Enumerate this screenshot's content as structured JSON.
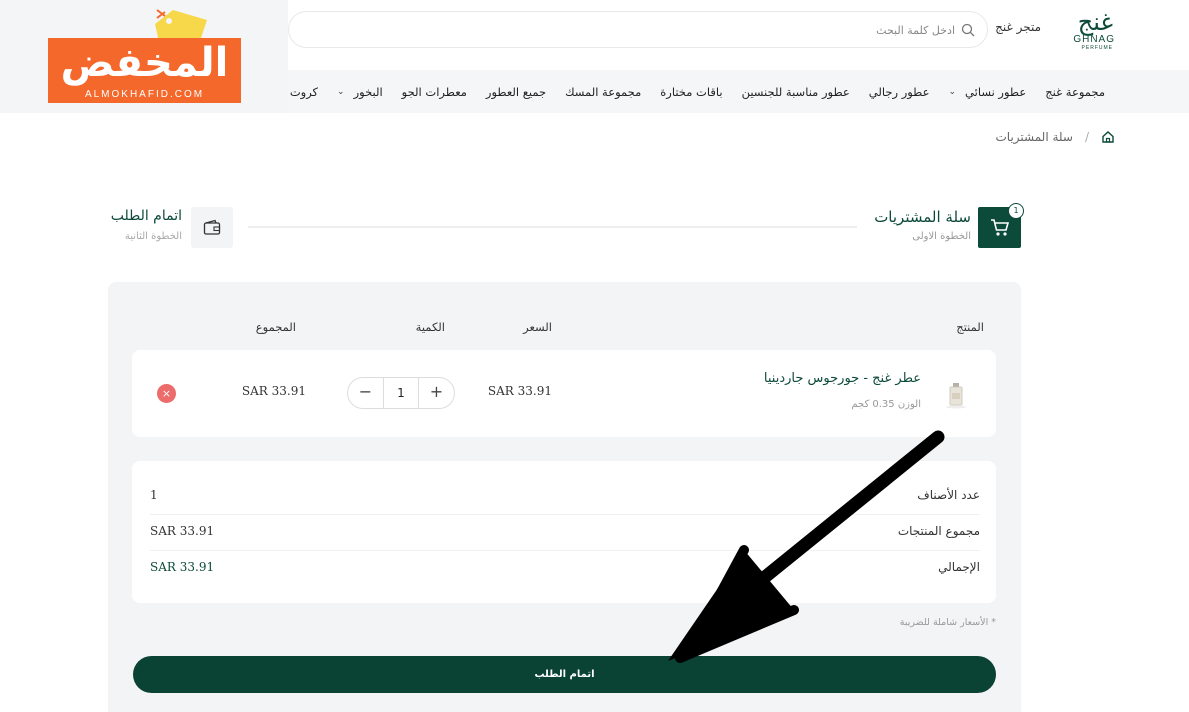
{
  "header": {
    "brand_script": "غنج",
    "brand_latin": "GHNAG",
    "brand_latin_sub": "PERFUME",
    "store_name": "متجر غنج",
    "search_placeholder": "ادخل كلمة البحث"
  },
  "nav": {
    "items": [
      {
        "label": "مجموعة غنج"
      },
      {
        "label": "عطور نسائي",
        "has_dropdown": true
      },
      {
        "label": "عطور رجالي"
      },
      {
        "label": "عطور مناسبة للجنسين"
      },
      {
        "label": "باقات مختارة"
      },
      {
        "label": "مجموعة المسك"
      },
      {
        "label": "جميع العطور"
      },
      {
        "label": "معطرات الجو"
      },
      {
        "label": "البخور",
        "has_dropdown": true
      },
      {
        "label": "كروت اه"
      }
    ]
  },
  "breadcrumb": {
    "current": "سلة المشتريات"
  },
  "steps": {
    "step1": {
      "title": "سلة المشتريات",
      "subtitle": "الخطوة الاولى",
      "badge": "1"
    },
    "step2": {
      "title": "اتمام الطلب",
      "subtitle": "الخطوة الثانية"
    }
  },
  "cart": {
    "headers": {
      "product": "المنتج",
      "price": "السعر",
      "quantity": "الكمية",
      "total": "المجموع"
    },
    "item": {
      "name": "عطر غنج - جورجوس جاردينيا",
      "weight": "الوزن 0.35 كجم",
      "price": "SAR 33.91",
      "quantity": "1",
      "total": "SAR 33.91",
      "minus": "−",
      "plus": "+",
      "remove": "×"
    }
  },
  "summary": {
    "rows": [
      {
        "label": "عدد الأصناف",
        "value": "1"
      },
      {
        "label": "مجموع المنتجات",
        "value": "SAR 33.91"
      },
      {
        "label": "الإجمالي",
        "value": "SAR 33.91"
      }
    ],
    "tax_note": "* الأسعار شاملة للضريبة",
    "checkout_label": "اتمام الطلب"
  },
  "watermark": {
    "text": "المخفض",
    "sub": "ALMOKHAFID.COM"
  },
  "colors": {
    "primary": "#0a4233",
    "accent_orange": "#f4682c",
    "remove_red": "#ec6b6b",
    "panel_bg": "#f3f4f6"
  }
}
